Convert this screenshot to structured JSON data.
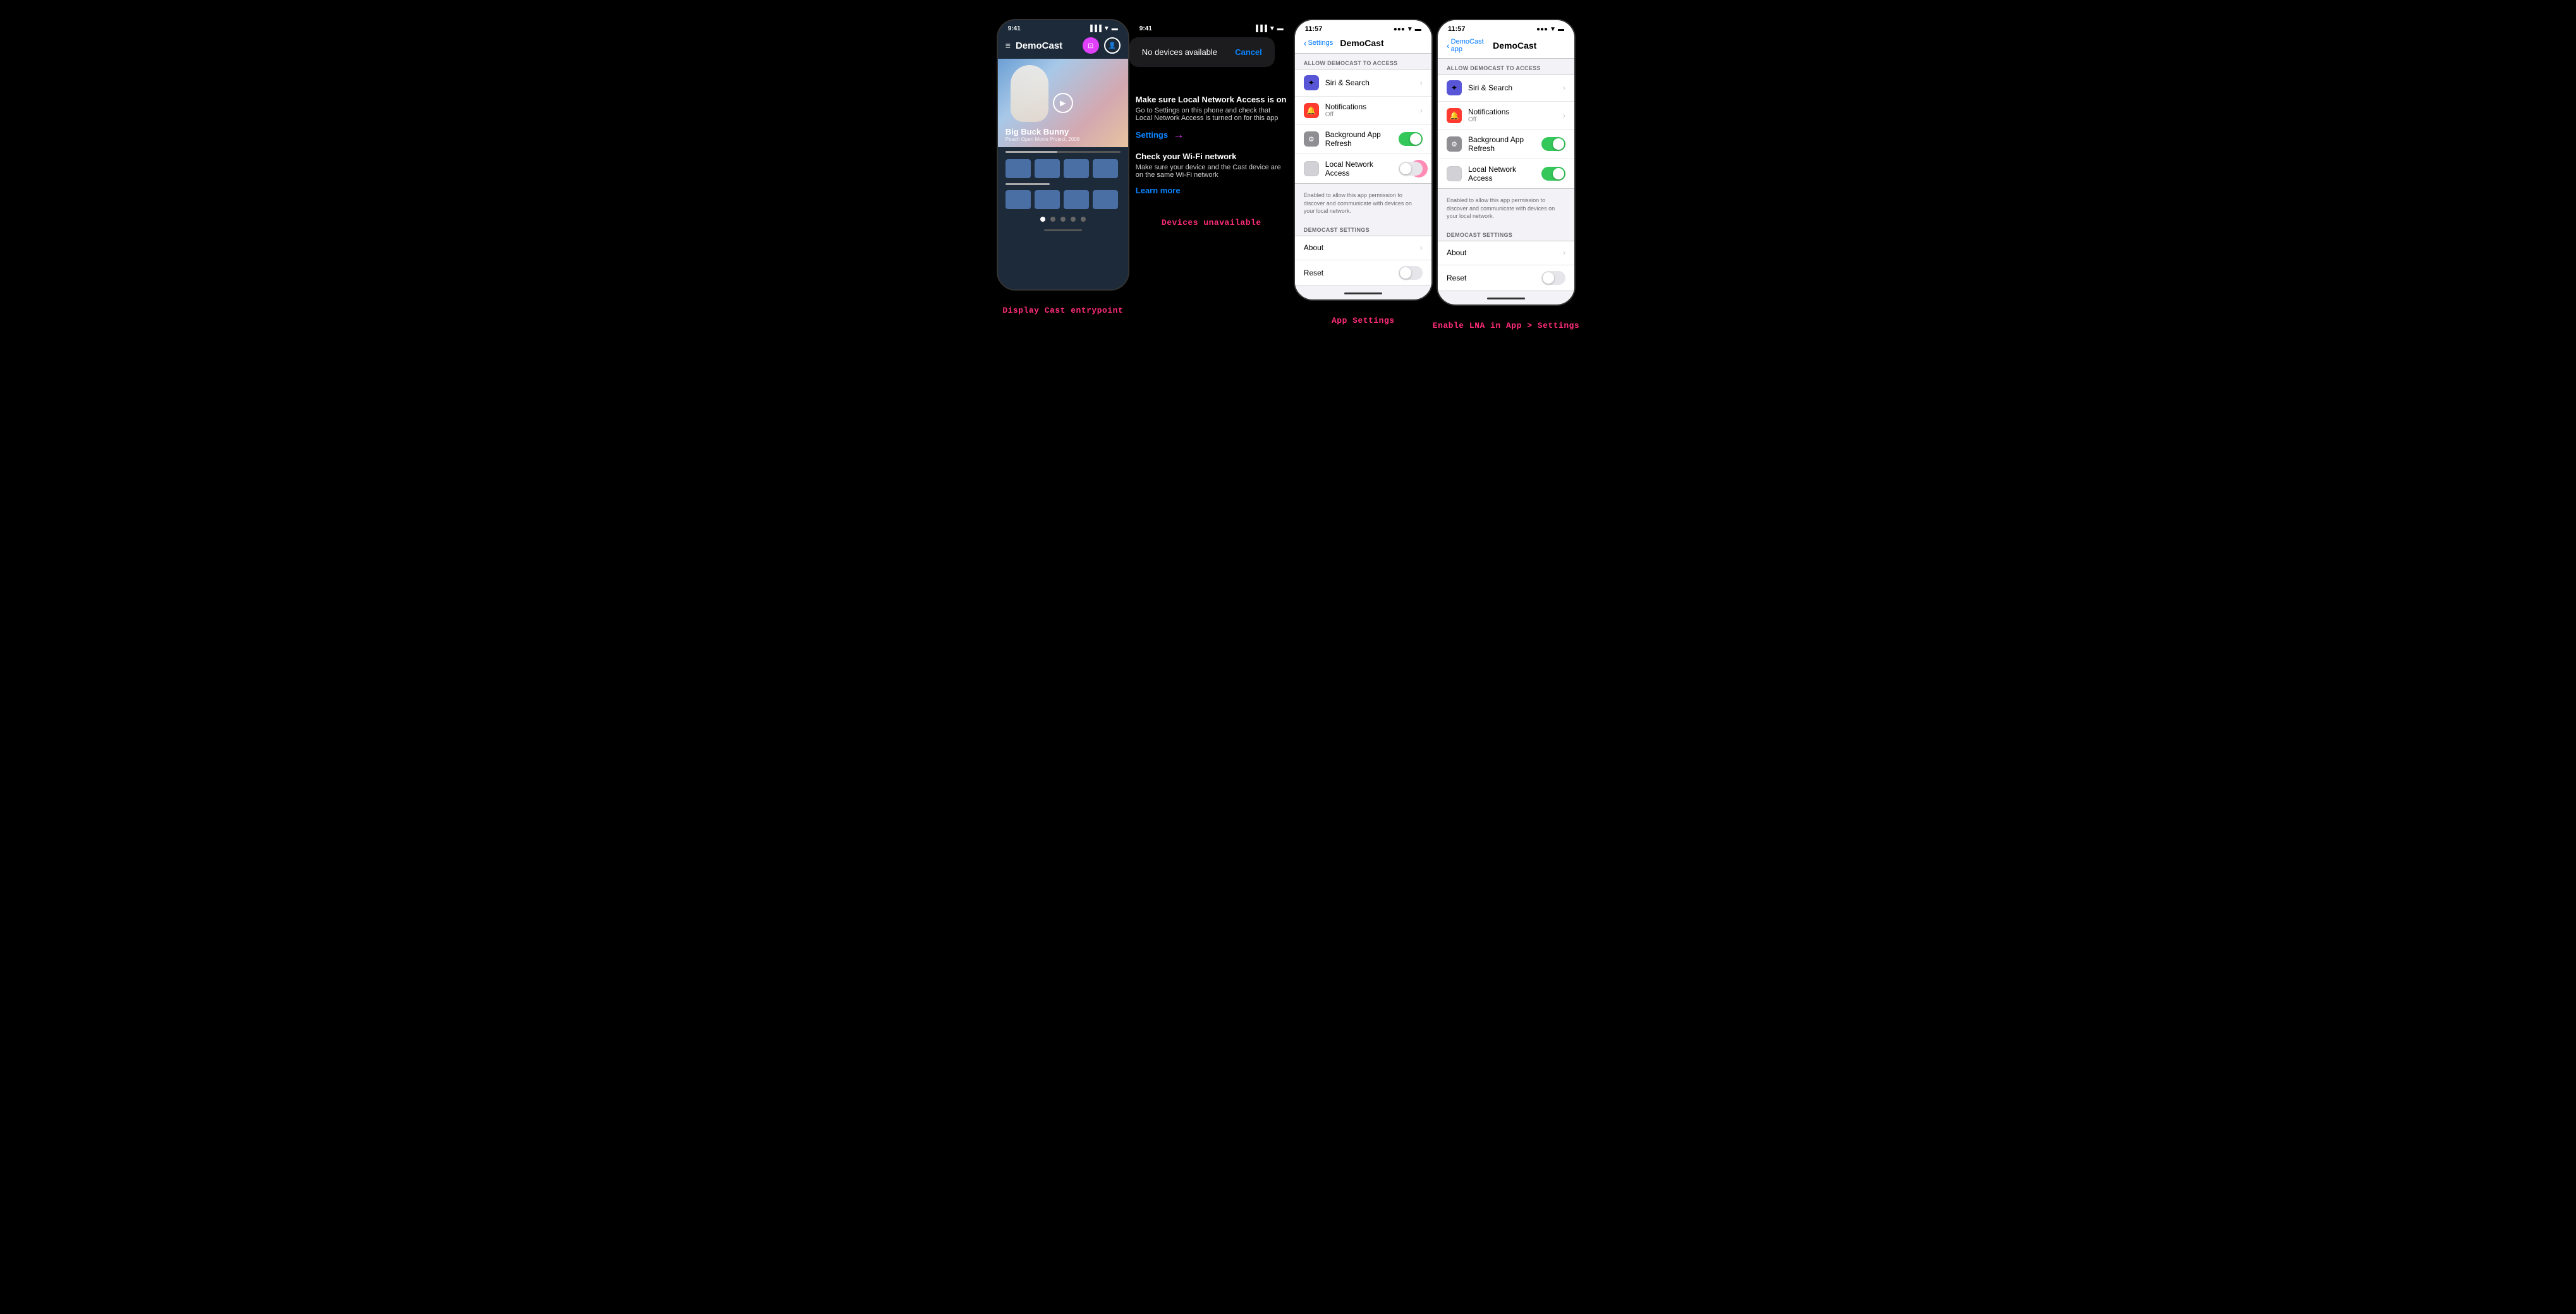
{
  "scene1": {
    "label": "Display Cast entrypoint",
    "status_time": "9:41",
    "app_title": "DemoCast",
    "hero_title": "Big Buck Bunny",
    "hero_subtitle": "Peach Open Movie Project, 2008"
  },
  "scene2": {
    "label": "Devices unavailable",
    "status_time": "9:41",
    "popup_text": "No devices available",
    "cancel_label": "Cancel",
    "inst1_title": "Make sure Local Network Access is on",
    "inst1_body": "Go to Settings on this phone and check that Local Network Access is turned on for this app",
    "inst1_link": "Settings",
    "inst2_title": "Check your Wi-Fi network",
    "inst2_body": "Make sure your device and the Cast device are on the same Wi-Fi network",
    "inst2_link": "Learn more"
  },
  "scene3": {
    "label": "App Settings",
    "status_time": "11:57",
    "back_label": "Settings",
    "page_title": "DemoCast",
    "section1_header": "ALLOW DEMOCAST TO ACCESS",
    "rows": [
      {
        "icon": "🔮",
        "icon_class": "icon-purple",
        "title": "Siri & Search",
        "sub": "",
        "type": "chevron"
      },
      {
        "icon": "🔴",
        "icon_class": "icon-red",
        "title": "Notifications",
        "sub": "Off",
        "type": "chevron"
      },
      {
        "icon": "⚙️",
        "icon_class": "icon-gray",
        "title": "Background App Refresh",
        "sub": "",
        "type": "toggle-on"
      },
      {
        "icon": "",
        "icon_class": "icon-gray-light",
        "title": "Local Network Access",
        "sub": "",
        "type": "toggle-off-cursor"
      }
    ],
    "lna_desc": "Enabled to allow this app permission to discover and communicate with devices on your local network.",
    "section2_header": "DEMOCAST SETTINGS",
    "rows2": [
      {
        "title": "About",
        "type": "chevron"
      },
      {
        "title": "Reset",
        "type": "toggle-off"
      }
    ]
  },
  "scene4": {
    "label": "Enable LNA in App > Settings",
    "status_time": "11:57",
    "back_label": "DemoCast app",
    "page_title": "DemoCast",
    "section1_header": "ALLOW DEMOCAST TO ACCESS",
    "rows": [
      {
        "icon": "🔮",
        "icon_class": "icon-purple",
        "title": "Siri & Search",
        "sub": "",
        "type": "chevron"
      },
      {
        "icon": "🔴",
        "icon_class": "icon-red",
        "title": "Notifications",
        "sub": "Off",
        "type": "chevron"
      },
      {
        "icon": "⚙️",
        "icon_class": "icon-gray",
        "title": "Background App Refresh",
        "sub": "",
        "type": "toggle-on"
      },
      {
        "icon": "",
        "icon_class": "icon-gray-light",
        "title": "Local Network Access",
        "sub": "",
        "type": "toggle-on"
      }
    ],
    "lna_desc": "Enabled to allow this app permission to discover and communicate with devices on your local network.",
    "section2_header": "DEMOCAST SETTINGS",
    "rows2": [
      {
        "title": "About",
        "type": "chevron"
      },
      {
        "title": "Reset",
        "type": "toggle-off"
      }
    ]
  }
}
